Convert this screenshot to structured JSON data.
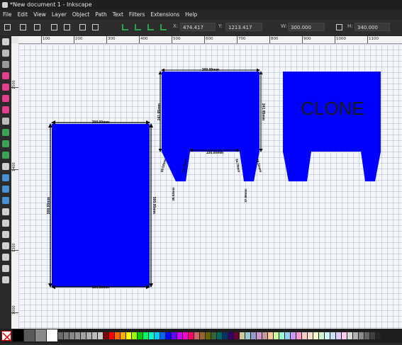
{
  "window": {
    "title": "*New document 1 - Inkscape"
  },
  "menubar": {
    "items": [
      "File",
      "Edit",
      "View",
      "Layer",
      "Object",
      "Path",
      "Text",
      "Filters",
      "Extensions",
      "Help"
    ]
  },
  "toolbar": {
    "x_label": "X:",
    "x_value": "474.417",
    "y_label": "Y:",
    "y_value": "1213.417",
    "w_label": "W:",
    "w_value": "300.000",
    "h_label": "H:",
    "h_value": "340.000"
  },
  "ruler": {
    "h_labels": [
      "100",
      "200",
      "300",
      "400",
      "500",
      "600",
      "700",
      "800",
      "900",
      "1000",
      "1100"
    ],
    "v_labels": [
      "1500",
      "1400",
      "1300",
      "1000"
    ]
  },
  "canvas": {
    "fill_color": "#0000ff",
    "rect_dims": {
      "top": "300.00mm",
      "bottom": "300.00mm",
      "left": "500.00mm",
      "right": "500.00mm"
    },
    "shape_dims": {
      "top": "300.00mm",
      "inner": "150.00mm",
      "left_side": "241.95mm",
      "right_side": "241.95mm",
      "left_leg_outer": "69.52mm",
      "left_leg_inner": "84.79mm",
      "right_leg_inner": "84.79mm",
      "right_leg_outer": "69.52mm",
      "left_foot": "39.53mm",
      "right_foot": "37.50mm"
    },
    "clone_text": "CLONE"
  },
  "palette": {
    "colors": [
      "#000000",
      "#5a5a5a",
      "#8a8a8a",
      "#ffffff",
      "#6b6b6b",
      "#7a7a7a",
      "#888888",
      "#959595",
      "#a2a2a2",
      "#afafaf",
      "#bcbcbc",
      "#c9c9c9",
      "#800000",
      "#ff0000",
      "#ff6600",
      "#ffaa00",
      "#ffff00",
      "#99ff00",
      "#00cc00",
      "#00ff66",
      "#00ffcc",
      "#00ccff",
      "#0066ff",
      "#0000ff",
      "#6600ff",
      "#cc00ff",
      "#ff00cc",
      "#ff0066",
      "#cc6666",
      "#996633",
      "#666600",
      "#336633",
      "#006666",
      "#003366",
      "#330066",
      "#660033",
      "#cccc99",
      "#99cccc",
      "#9999cc",
      "#cc99cc",
      "#cc9999",
      "#ffcc99",
      "#ccff99",
      "#99ffcc",
      "#99ccff",
      "#cc99ff",
      "#ff99cc",
      "#ffcccc",
      "#ffe0cc",
      "#ffffcc",
      "#ccffcc",
      "#ccffff",
      "#cce0ff",
      "#e0ccff",
      "#ffccf0",
      "#d9d9d9",
      "#b3b3b3",
      "#8c8c8c",
      "#666666",
      "#404040",
      "#262626"
    ]
  }
}
